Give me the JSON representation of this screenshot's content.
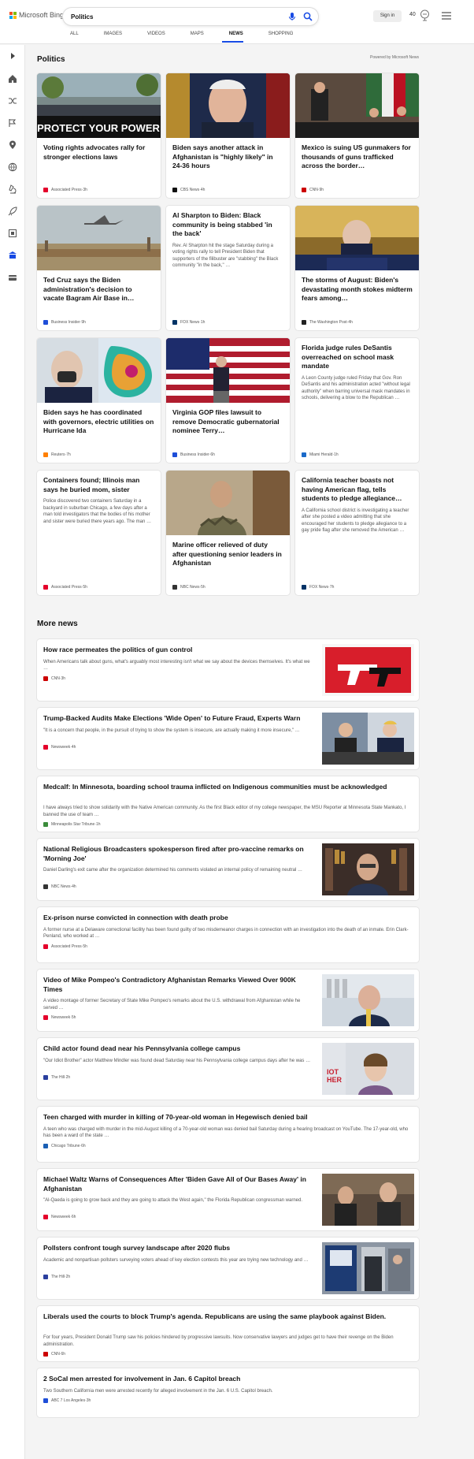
{
  "header": {
    "brand": "Microsoft Bing",
    "query": "Politics",
    "signin_label": "Sign in",
    "points": "40",
    "tabs": [
      "ALL",
      "IMAGES",
      "VIDEOS",
      "MAPS",
      "NEWS",
      "SHOPPING"
    ],
    "active_tab": "NEWS"
  },
  "section": {
    "title": "Politics",
    "powered_by": "Powered by Microsoft News"
  },
  "cards": [
    {
      "title": "Voting rights advocates rally for stronger elections laws",
      "source": "Associated Press",
      "age": "3h",
      "image_text": "PROTECT YOUR POWER",
      "desc": ""
    },
    {
      "title": "Biden says another attack in Afghanistan is \"highly likely\" in 24-36 hours",
      "source": "CBS News",
      "age": "4h",
      "desc": ""
    },
    {
      "title": "Mexico is suing US gunmakers for thousands of guns trafficked across the border…",
      "source": "CNN",
      "age": "9h",
      "desc": ""
    },
    {
      "title": "Ted Cruz says the Biden administration's decision to vacate Bagram Air Base in…",
      "source": "Business Insider",
      "age": "9h",
      "desc": ""
    },
    {
      "title": "Al Sharpton to Biden: Black community is being stabbed 'in the back'",
      "source": "FOX News",
      "age": "1h",
      "desc": "Rev. Al Sharpton hit the stage Saturday during a voting rights rally to tell President Biden that supporters of the filibuster are \"stabbing\" the Black community \"in the back,\" …"
    },
    {
      "title": "The storms of August: Biden's devastating month stokes midterm fears among…",
      "source": "The Washington Post",
      "age": "4h",
      "desc": ""
    },
    {
      "title": "Biden says he has coordinated with governors, electric utilities on Hurricane Ida",
      "source": "Reuters",
      "age": "7h",
      "desc": ""
    },
    {
      "title": "Virginia GOP files lawsuit to remove Democratic gubernatorial nominee Terry…",
      "source": "Business Insider",
      "age": "6h",
      "desc": ""
    },
    {
      "title": "Florida judge rules DeSantis overreached on school mask mandate",
      "source": "Miami Herald",
      "age": "1h",
      "desc": "A Leon County judge ruled Friday that Gov. Ron DeSantis and his administration acted \"without legal authority\" when barring universal mask mandates in schools, delivering a blow to the Republican …"
    },
    {
      "title": "Containers found; Illinois man says he buried mom, sister",
      "source": "Associated Press",
      "age": "5h",
      "desc": "Police discovered two containers Saturday in a backyard in suburban Chicago, a few days after a man told investigators that the bodies of his mother and sister were buried there years ago. The man …"
    },
    {
      "title": "Marine officer relieved of duty after questioning senior leaders in Afghanistan",
      "source": "NBC News",
      "age": "5h",
      "desc": ""
    },
    {
      "title": "California teacher boasts not having American flag, tells students to pledge allegiance…",
      "source": "FOX News",
      "age": "7h",
      "desc": "A California school district is investigating a teacher after she posted a video admitting that she encouraged her students to pledge allegiance to a gay pride flag after she removed the American …"
    }
  ],
  "more_news": {
    "title": "More news",
    "items": [
      {
        "title": "How race permeates the politics of gun control",
        "desc": "When Americans talk about guns, what's arguably most interesting isn't what we say about the devices themselves. It's what we …",
        "source": "CNN",
        "age": "3h"
      },
      {
        "title": "Trump-Backed Audits Make Elections 'Wide Open' to Future Fraud, Experts Warn",
        "desc": "\"It is a concern that people, in the pursuit of trying to show the system is insecure, are actually making it more insecure,\" …",
        "source": "Newsweek",
        "age": "4h"
      },
      {
        "title": "Medcalf: In Minnesota, boarding school trauma inflicted on Indigenous communities must be acknowledged",
        "desc": "I have always tried to show solidarity with the Native American community. As the first Black editor of my college newspaper, the MSU Reporter at Minnesota State Mankato, I banned the use of team …",
        "source": "Minneapolis Star Tribune",
        "age": "1h"
      },
      {
        "title": "National Religious Broadcasters spokesperson fired after pro-vaccine remarks on 'Morning Joe'",
        "desc": "Daniel Darling's exit came after the organization determined his comments violated an internal policy of remaining neutral …",
        "source": "NBC News",
        "age": "4h"
      },
      {
        "title": "Ex-prison nurse convicted in connection with death probe",
        "desc": "A former nurse at a Delaware correctional facility has been found guilty of two misdemeanor charges in connection with an investigation into the death of an inmate. Erin Clark-Penland, who worked at …",
        "source": "Associated Press",
        "age": "5h"
      },
      {
        "title": "Video of Mike Pompeo's Contradictory Afghanistan Remarks Viewed Over 900K Times",
        "desc": "A video montage of former Secretary of State Mike Pompeo's remarks about the U.S. withdrawal from Afghanistan while he served …",
        "source": "Newsweek",
        "age": "5h"
      },
      {
        "title": "Child actor found dead near his Pennsylvania college campus",
        "desc": "\"Our Idiot Brother\" actor Matthew Mindler was found dead Saturday near his Pennsylvania college campus days after he was …",
        "source": "The Hill",
        "age": "2h"
      },
      {
        "title": "Teen charged with murder in killing of 70-year-old woman in Hegewisch denied bail",
        "desc": "A teen who was charged with murder in the mid-August killing of a 70-year-old woman was denied bail Saturday during a hearing broadcast on YouTube. The 17-year-old, who has been a ward of the state …",
        "source": "Chicago Tribune",
        "age": "6h"
      },
      {
        "title": "Michael Waltz Warns of Consequences After 'Biden Gave All of Our Bases Away' in Afghanistan",
        "desc": "\"Al-Qaeda is going to grow back and they are going to attack the West again,\" the Florida Republican congressman warned.",
        "source": "Newsweek",
        "age": "6h"
      },
      {
        "title": "Pollsters confront tough survey landscape after 2020 flubs",
        "desc": "Academic and nonpartisan pollsters surveying voters ahead of key election contests this year are trying new technology and …",
        "source": "The Hill",
        "age": "2h"
      },
      {
        "title": "Liberals used the courts to block Trump's agenda. Republicans are using the same playbook against Biden.",
        "desc": "For four years, President Donald Trump saw his policies hindered by progressive lawsuits. Now conservative lawyers and judges get to have their revenge on the Biden administration.",
        "source": "CNN",
        "age": "6h"
      },
      {
        "title": "2 SoCal men arrested for involvement in Jan. 6 Capitol breach",
        "desc": "Two Southern California men were arrested recently for alleged involvement in the Jan. 6 U.S. Capitol breach.",
        "source": "ABC 7 Los Angeles",
        "age": "3h"
      }
    ]
  },
  "colors": {
    "accent": "#174ae4",
    "bing_teal": "#008373"
  }
}
